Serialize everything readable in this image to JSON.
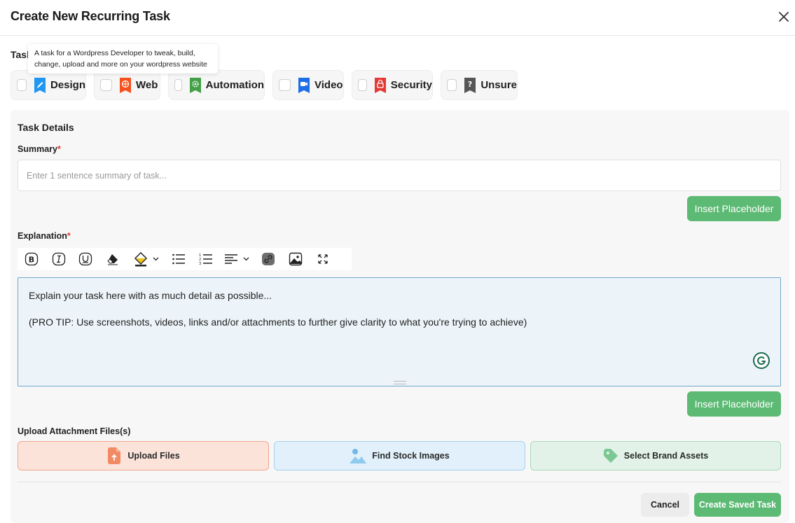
{
  "modal": {
    "title": "Create New Recurring Task",
    "close_icon": "close-icon"
  },
  "category": {
    "label": "Task",
    "tooltip": "A task for a Wordpress Developer to tweak, build, change, upload and more on your wordpress website",
    "options": [
      {
        "label": "Design",
        "icon": "pencil-icon",
        "color": "#2196f3"
      },
      {
        "label": "Web",
        "icon": "globe-icon",
        "color": "#f4511e"
      },
      {
        "label": "Automation",
        "icon": "gear-icon",
        "color": "#43a047"
      },
      {
        "label": "Video",
        "icon": "video-camera-icon",
        "color": "#1e6ee8"
      },
      {
        "label": "Security",
        "icon": "lock-icon",
        "color": "#e53935"
      },
      {
        "label": "Unsure",
        "icon": "question-mark-icon",
        "color": "#555555"
      }
    ]
  },
  "details": {
    "title": "Task Details",
    "summary_label": "Summary",
    "summary_placeholder": "Enter 1 sentence summary of task...",
    "summary_value": "",
    "required_marker": "*",
    "insert_placeholder_label": "Insert Placeholder",
    "explanation_label": "Explanation",
    "editor_lines": [
      "Explain your task here with as much detail as possible...",
      "(PRO TIP: Use screenshots, videos, links and/or attachments to further give clarity to what you're trying to achieve)"
    ]
  },
  "toolbar": [
    "bold-icon",
    "italic-icon",
    "underline-icon",
    "eraser-icon",
    "fill-color-icon",
    "bullet-list-icon",
    "numbered-list-icon",
    "align-icon",
    "link-icon",
    "image-icon",
    "fullscreen-icon"
  ],
  "attachments": {
    "label": "Upload Attachment Files(s)",
    "upload_files": "Upload Files",
    "stock_images": "Find Stock Images",
    "brand_assets": "Select Brand Assets"
  },
  "footer": {
    "cancel": "Cancel",
    "create": "Create Saved Task"
  },
  "colors": {
    "accent_green": "#5dba74",
    "editor_bg": "#ecf4f9",
    "editor_border": "#6fa8cc"
  }
}
